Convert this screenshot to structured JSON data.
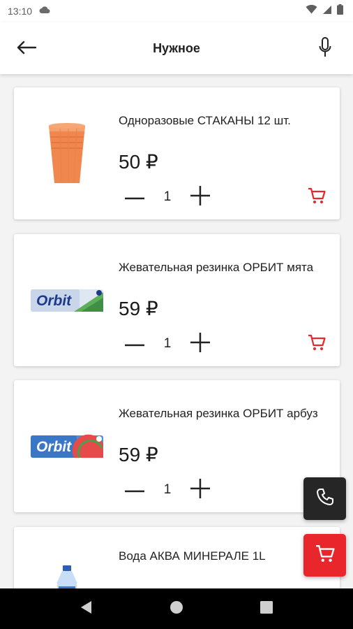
{
  "status_bar": {
    "time": "13:10"
  },
  "app_bar": {
    "title": "Нужное"
  },
  "products": [
    {
      "name": "Одноразовые СТАКАНЫ 12 шт.",
      "price": "50 ₽",
      "quantity": "1",
      "image": "cups"
    },
    {
      "name": "Жевательная резинка ОРБИТ мята",
      "price": "59 ₽",
      "quantity": "1",
      "image": "orbit-mint",
      "brand_label": "Orbit"
    },
    {
      "name": "Жевательная резинка ОРБИТ арбуз",
      "price": "59 ₽",
      "quantity": "1",
      "image": "orbit-watermelon",
      "brand_label": "Orbit"
    },
    {
      "name": "Вода АКВА МИНЕРАЛЕ 1L",
      "image": "water-bottle"
    }
  ],
  "colors": {
    "accent": "#e8262b",
    "call_fab": "#262626"
  }
}
